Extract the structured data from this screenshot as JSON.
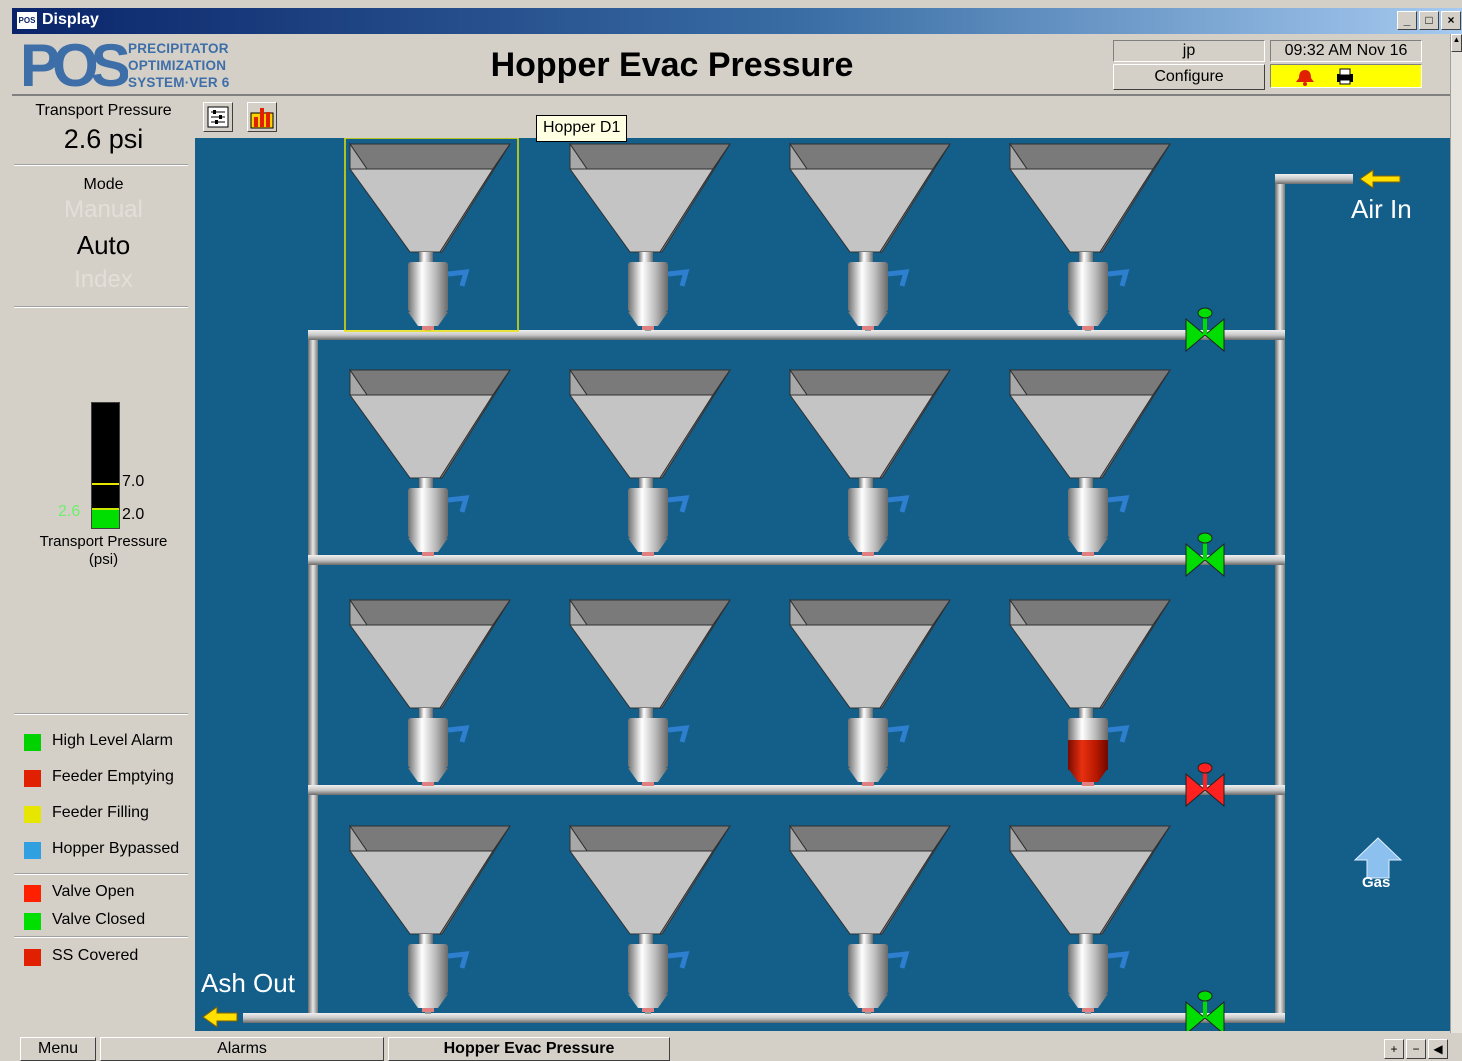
{
  "window": {
    "title": "Display",
    "icon_text": "POS"
  },
  "header": {
    "logo_text": "POS",
    "logo_lines": [
      "PRECIPITATOR",
      "OPTIMIZATION",
      "SYSTEM·VER 6"
    ],
    "page_title": "Hopper Evac Pressure",
    "user": "jp",
    "configure_label": "Configure",
    "datetime": "09:32 AM Nov 16",
    "alarm_box_color": "#ffff00"
  },
  "left_panel": {
    "transport_pressure_label": "Transport Pressure",
    "transport_pressure_value": "2.6 psi",
    "mode_label": "Mode",
    "mode_options": [
      "Manual",
      "Auto",
      "Index"
    ],
    "mode_selected": "Auto",
    "gauge": {
      "value": 2.6,
      "value_text": "2.6",
      "high_text": "7.0",
      "low_text": "2.0",
      "label": "Transport Pressure",
      "units": "(psi)"
    },
    "legend_status": [
      {
        "label": "High Level Alarm",
        "color": "#00d200"
      },
      {
        "label": "Feeder Emptying",
        "color": "#e02000"
      },
      {
        "label": "Feeder Filling",
        "color": "#e6e600"
      },
      {
        "label": "Hopper Bypassed",
        "color": "#30a0e0"
      }
    ],
    "legend_valve": [
      {
        "label": "Valve Open",
        "color": "#ff2000"
      },
      {
        "label": "Valve Closed",
        "color": "#00e000"
      }
    ],
    "legend_ss": [
      {
        "label": "SS Covered",
        "color": "#e02000"
      }
    ]
  },
  "toolbar": {
    "icons": [
      "settings-list-icon",
      "trend-chart-icon"
    ]
  },
  "diagram": {
    "tooltip": "Hopper D1",
    "air_in_label": "Air In",
    "ash_out_label": "Ash Out",
    "gas_label": "Gas",
    "rows": [
      {
        "valve_state": "closed",
        "feeders": [
          "normal",
          "normal",
          "normal",
          "normal"
        ]
      },
      {
        "valve_state": "closed",
        "feeders": [
          "normal",
          "normal",
          "normal",
          "normal"
        ]
      },
      {
        "valve_state": "open",
        "feeders": [
          "normal",
          "normal",
          "normal",
          "emptying"
        ]
      },
      {
        "valve_state": "closed",
        "feeders": [
          "normal",
          "normal",
          "normal",
          "normal"
        ]
      }
    ],
    "selected_hopper": {
      "row": 0,
      "col": 0
    },
    "valve_colors": {
      "open": "#ff2020",
      "closed": "#00dd00"
    },
    "feeder_emptying_color": "#c81400"
  },
  "statusbar": {
    "tabs": [
      "Menu",
      "Alarms",
      "Hopper Evac Pressure"
    ],
    "active_tab": "Hopper Evac Pressure",
    "buttons": [
      "+",
      "−",
      "◀"
    ]
  }
}
